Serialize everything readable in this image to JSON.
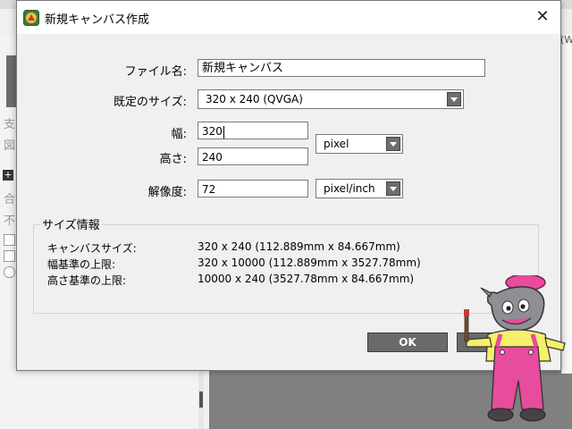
{
  "dialog": {
    "title": "新規キャンバス作成",
    "file_name_label": "ファイル名:",
    "file_name_value": "新規キャンバス",
    "preset_label": "既定のサイズ:",
    "preset_value": "320 x  240 (QVGA)",
    "width_label": "幅:",
    "width_value": "320",
    "height_label": "高さ:",
    "height_value": "240",
    "size_unit": "pixel",
    "resolution_label": "解像度:",
    "resolution_value": "72",
    "resolution_unit": "pixel/inch",
    "info": {
      "title": "サイズ情報",
      "rows": [
        {
          "key": "キャンバスサイズ:",
          "value": "320 x 240 (112.889mm x 84.667mm)"
        },
        {
          "key": "幅基準の上限:",
          "value": "320 x 10000 (112.889mm x 3527.78mm)"
        },
        {
          "key": "高さ基準の上限:",
          "value": "10000 x 240 (3527.78mm x 84.667mm)"
        }
      ]
    },
    "ok_label": "OK",
    "close_glyph": "✕"
  },
  "background": {
    "left_glyphs": [
      "支",
      "図",
      "合",
      "不"
    ],
    "right_edge_text": "(W"
  },
  "icons": {
    "app": "app-icon",
    "close": "close-icon",
    "dropdown": "chevron-down-icon"
  },
  "colors": {
    "button": "#6a6a6a",
    "mascot_pink": "#e84c9c",
    "mascot_yellow": "#f5ef6a"
  }
}
